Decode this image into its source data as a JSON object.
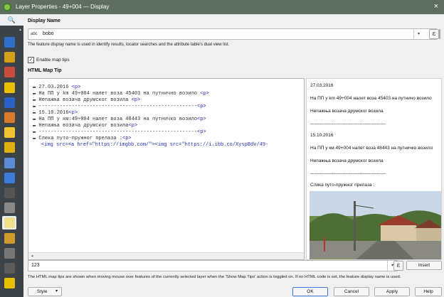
{
  "window": {
    "title": "Layer Properties - 49+004 — Display",
    "close_glyph": "×"
  },
  "sidebar": {
    "search_glyph": "🔍",
    "items": [
      {
        "name": "information",
        "color": "#2f6fc8"
      },
      {
        "name": "source",
        "color": "#d4a017"
      },
      {
        "name": "symbology",
        "color": "#c94b3b"
      },
      {
        "name": "labels",
        "color": "#e8c000"
      },
      {
        "name": "masks",
        "color": "#2a62c8"
      },
      {
        "name": "3d-view",
        "color": "#d87a2c"
      },
      {
        "name": "diagrams",
        "color": "#f1c232"
      },
      {
        "name": "fields",
        "color": "#e0b010"
      },
      {
        "name": "attributes-form",
        "color": "#5a8bd4"
      },
      {
        "name": "joins",
        "color": "#3b7dd8"
      },
      {
        "name": "auxiliary-storage",
        "color": "#555"
      },
      {
        "name": "actions",
        "color": "#888"
      },
      {
        "name": "display",
        "color": "#f0e08a"
      },
      {
        "name": "rendering",
        "color": "#d19a2f"
      },
      {
        "name": "temporal",
        "color": "#777"
      },
      {
        "name": "variables",
        "color": "#5c5c5c"
      },
      {
        "name": "metadata",
        "color": "#e8c000"
      }
    ]
  },
  "display_name": {
    "heading": "Display Name",
    "prefix": "abc",
    "value": "bobo",
    "note": "The feature display name is used in identify results, locator searches and the attribute table's dual view list."
  },
  "map_tips": {
    "checkbox_label": "Enable map tips",
    "checked_glyph": "✓",
    "heading": "HTML Map Tip"
  },
  "code_lines": [
    {
      "text": "27.03.2016 <p>",
      "fold": true,
      "indent": 0
    },
    {
      "text": "На ПП у km 49+004 налет воза 45403 на путнично возило <p>",
      "fold": true,
      "indent": 0
    },
    {
      "text": "Непажња возача друмског возила <p>",
      "fold": true,
      "indent": 0
    },
    {
      "text": "-----------------------------------------------------<p>",
      "fold": true,
      "indent": 0
    },
    {
      "text": "15.10.2016<p>",
      "fold": true,
      "indent": 0
    },
    {
      "text": "На ПП у км:49+004 налет воза 48443 на путничко возило<p>",
      "fold": true,
      "indent": 0
    },
    {
      "text": "Непажња возача друмског возила<p>",
      "fold": true,
      "indent": 0
    },
    {
      "text": "-----------------------------------------------------<p>",
      "fold": true,
      "indent": 0
    },
    {
      "text": "Слика путо-пружног прелаза :<p>",
      "fold": true,
      "indent": 0
    },
    {
      "text": "<img src=<a href=\"https://imgbb.com/\"><img src=\"https://i.ibb.co/XyspBdv/49-",
      "fold": false,
      "indent": 1
    }
  ],
  "preview": {
    "lines": [
      "27.03.2016",
      "На ПП у km 49+004 налет воза 45403 на путничо возило",
      "Непажња возача друмског возила",
      "-------------------------------------------------",
      "15.10.2016",
      "На ПП у км:49+004 налет воза 48443 на путничко возило",
      "Непажња возача друмског возила",
      "-------------------------------------------------",
      "Слика путо-пружног прелаза :"
    ]
  },
  "expression": {
    "value": "123",
    "insert_label": "Insert"
  },
  "footer_note": "The HTML map tips are shown when moving mouse over features of the currently selected layer when the 'Show Map Tips' action is toggled on. If no HTML code is set, the feature display name is used.",
  "buttons": {
    "style": "Style",
    "ok": "OK",
    "cancel": "Cancel",
    "apply": "Apply",
    "help": "Help"
  },
  "glyphs": {
    "dropdown": "▾",
    "epsilon": "ε",
    "scroll_left": "◂",
    "scroll_up": "▴"
  }
}
